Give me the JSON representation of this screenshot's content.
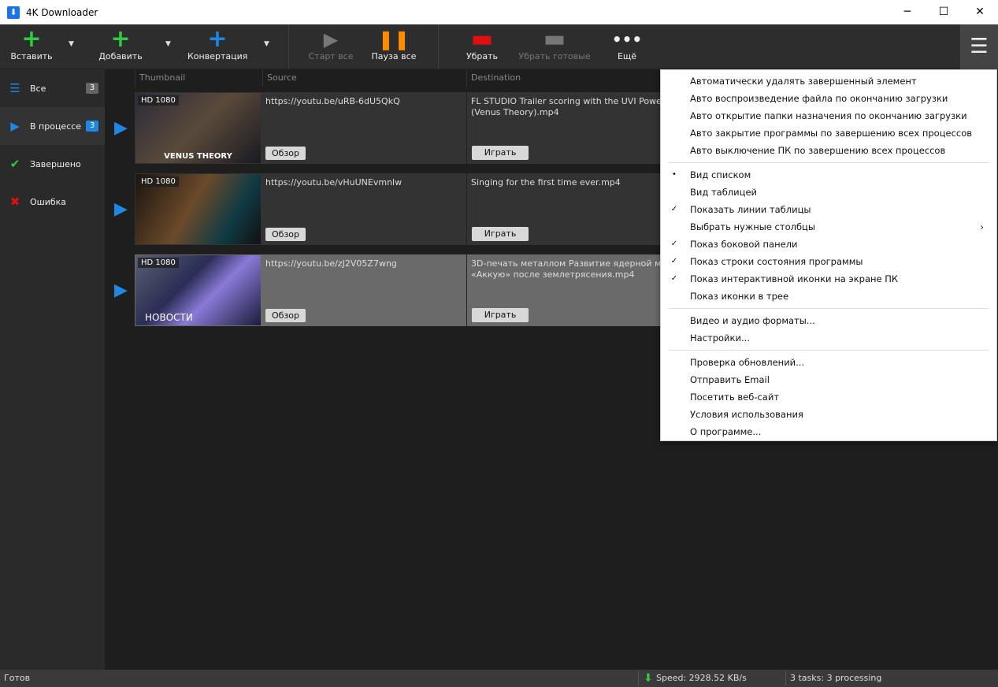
{
  "window": {
    "title": "4K Downloader",
    "minimize": "─",
    "maximize": "☐",
    "close": "✕"
  },
  "toolbar": {
    "paste": "Вставить",
    "add": "Добавить",
    "convert": "Конвертация",
    "start_all": "Старт все",
    "pause_all": "Пауза все",
    "remove": "Убрать",
    "remove_done": "Убрать готовые",
    "more": "Ещё",
    "menu_icon": "☰"
  },
  "sidebar": {
    "items": [
      {
        "label": "Все",
        "count": "3"
      },
      {
        "label": "В процессе",
        "count": "3"
      },
      {
        "label": "Завершено"
      },
      {
        "label": "Ошибка"
      }
    ]
  },
  "columns": {
    "thumbnail": "Thumbnail",
    "source": "Source",
    "destination": "Destination"
  },
  "rows": [
    {
      "quality": "HD 1080",
      "caption": "VENUS THEORY",
      "source": "https://youtu.be/uRB-6dU5QkQ",
      "destination": "FL STUDIO   Trailer scoring with the UVI Power Bundle (Venus Theory).mp4",
      "browse": "Обзор",
      "play": "Играть"
    },
    {
      "quality": "HD 1080",
      "caption": "",
      "source": "https://youtu.be/vHuUNEvmnlw",
      "destination": "Singing for the first time ever.mp4",
      "browse": "Обзор",
      "play": "Играть"
    },
    {
      "quality": "HD 1080",
      "caption": "НОВОСТИ",
      "source": "https://youtu.be/zJ2V05Z7wng",
      "destination": "3D-печать металлом   Развитие ядерной медицины   АЭС «Аккую» после землетрясения.mp4",
      "browse": "Обзор",
      "play": "Играть"
    }
  ],
  "menu": {
    "items": [
      {
        "label": "Автоматически удалять завершенный элемент"
      },
      {
        "label": "Авто воспроизведение файла по окончанию загрузки"
      },
      {
        "label": "Авто открытие папки назначения по окончанию загрузки"
      },
      {
        "label": "Авто закрытие программы по завершению всех процессов"
      },
      {
        "label": "Авто выключение ПК по завершению всех процессов"
      },
      {
        "label": "Вид списком",
        "mark": "•"
      },
      {
        "label": "Вид таблицей"
      },
      {
        "label": "Показать линии таблицы",
        "mark": "✓"
      },
      {
        "label": "Выбрать нужные столбцы",
        "submenu": "›"
      },
      {
        "label": "Показ боковой панели",
        "mark": "✓"
      },
      {
        "label": "Показ строки состояния программы",
        "mark": "✓"
      },
      {
        "label": "Показ интерактивной иконки на экране ПК",
        "mark": "✓"
      },
      {
        "label": "Показ иконки в трее"
      },
      {
        "label": "Видео и аудио форматы..."
      },
      {
        "label": "Настройки..."
      },
      {
        "label": "Проверка обновлений..."
      },
      {
        "label": "Отправить Email"
      },
      {
        "label": "Посетить веб-сайт"
      },
      {
        "label": "Условия использования"
      },
      {
        "label": "О программе..."
      }
    ]
  },
  "status": {
    "text": "Готов",
    "speed": "Speed: 2928.52 KB/s",
    "tasks": "3 tasks: 3 processing"
  },
  "colors": {
    "green": "#2ecc40",
    "blue": "#1e88e5",
    "orange": "#ff8c00",
    "red": "#e01010"
  }
}
